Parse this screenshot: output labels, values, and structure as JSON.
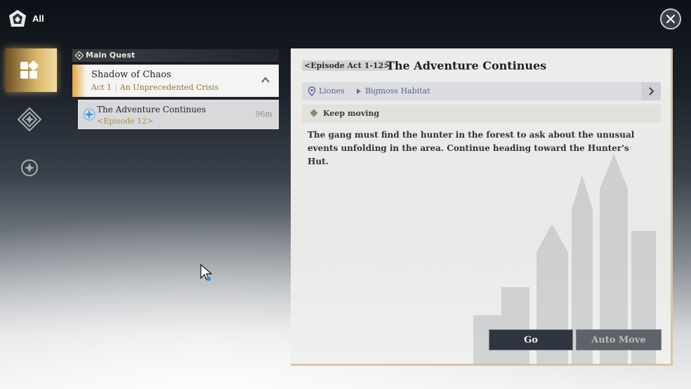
{
  "header": {
    "title": "All",
    "subtitle": "· · · · · ·",
    "menu_icon": "quest-log-emblem-icon",
    "close_icon": "close-icon"
  },
  "sidebar": {
    "items": [
      {
        "icon": "grid-squares-icon",
        "active": true
      },
      {
        "icon": "diamond-emblem-icon",
        "active": false
      },
      {
        "icon": "compass-icon",
        "active": false
      }
    ]
  },
  "quest_list": {
    "category_label": "Main Quest",
    "chapter": {
      "title": "Shadow of Chaos",
      "act": "Act 1",
      "act_name": "An Unprecedented Crisis",
      "separator": "|"
    },
    "quest": {
      "title": "The Adventure Continues",
      "episode": "<Episode 12>",
      "distance": "96m"
    }
  },
  "detail": {
    "episode_tag": "<Episode Act 1-12>",
    "title": "The Adventure Continues",
    "location_region": "Liones",
    "location_area": "Bigmoss Habitat",
    "objective": "Keep moving",
    "description": "The gang must find the hunter in the forest to ask about the unusual events unfolding in the area. Continue heading toward the Hunter's Hut.",
    "go_label": "Go",
    "auto_move_label": "Auto Move"
  },
  "colors": {
    "accent_gold": "#d9b56a",
    "location_text": "#5e5f9a",
    "sub_text_gold": "#9a7436"
  }
}
